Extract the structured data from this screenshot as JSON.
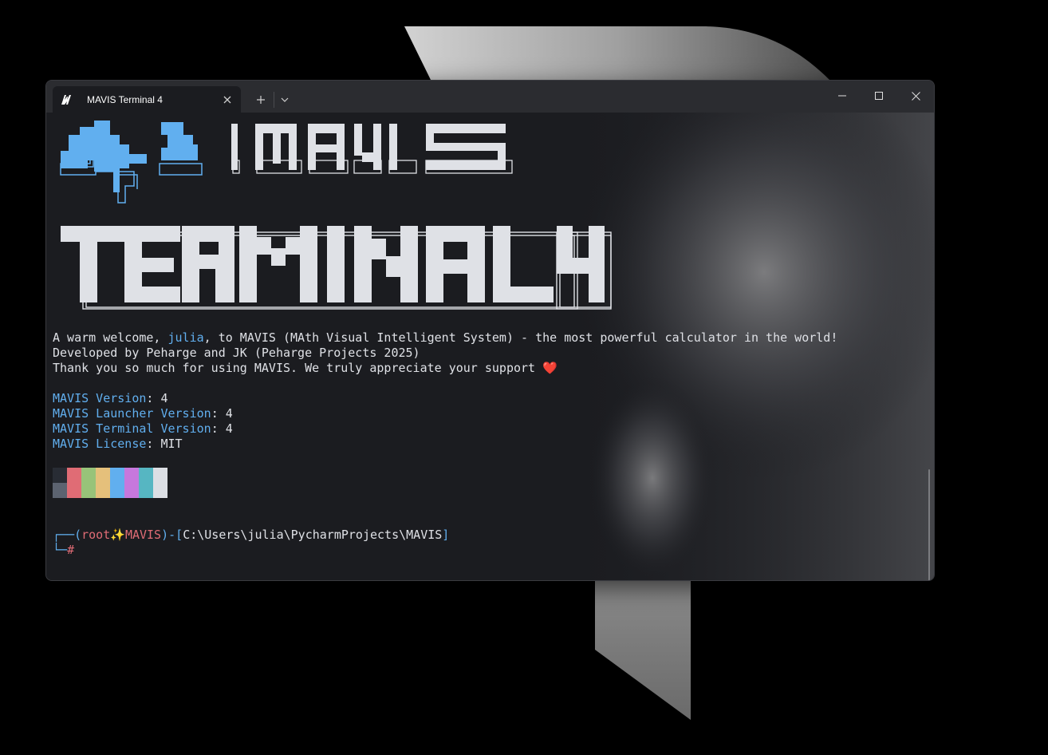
{
  "window": {
    "tab_title": "MAVIS Terminal 4",
    "app_icon": "mavis-logo-icon",
    "new_tab_icon": "plus-icon",
    "dropdown_icon": "chevron-down-icon",
    "controls": [
      "minimize-icon",
      "maximize-icon",
      "close-icon"
    ]
  },
  "banner": {
    "line1": "MAVIS",
    "line2": "TERMINAL 4",
    "logo_color": "#61afef",
    "text_color": "#dfe1e6"
  },
  "welcome": {
    "prefix": "A warm welcome, ",
    "user": "julia",
    "suffix": ", to MAVIS (MAth Visual Intelligent System) - the most powerful calculator in the world!",
    "developed": "Developed by Peharge and JK (Peharge Projects 2025)",
    "thanks": "Thank you so much for using MAVIS. We truly appreciate your support ",
    "heart": "❤️"
  },
  "info": [
    {
      "key": "MAVIS Version",
      "value": "4"
    },
    {
      "key": "MAVIS Launcher Version",
      "value": "4"
    },
    {
      "key": "MAVIS Terminal Version",
      "value": "4"
    },
    {
      "key": "MAVIS License",
      "value": "MIT"
    }
  ],
  "separator": ": ",
  "palette": {
    "top": [
      "#282c34",
      "#e06c75",
      "#98c379",
      "#e5c07b",
      "#61afef",
      "#c678dd",
      "#56b6c2",
      "#dcdfe4"
    ],
    "bottom": [
      "#5c6370",
      "#e06c75",
      "#98c379",
      "#e5c07b",
      "#61afef",
      "#c678dd",
      "#56b6c2",
      "#dcdfe4"
    ]
  },
  "prompt": {
    "corner_top": "┌──(",
    "user": "root",
    "sparkle": "✨",
    "host": "MAVIS",
    "mid": ")-[",
    "path": "C:\\Users\\julia\\PycharmProjects\\MAVIS",
    "end": "]",
    "corner_bottom": "└─",
    "symbol": "#"
  },
  "colors": {
    "accent": "#61afef",
    "prompt_red": "#e06c75",
    "background": "#1b1c20"
  }
}
